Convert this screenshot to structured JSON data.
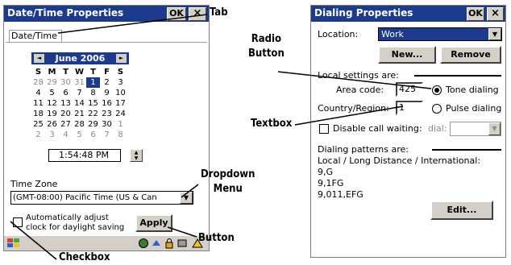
{
  "datetime_window": {
    "title": "Date/Time Properties",
    "ok_label": "OK",
    "close_glyph": "×",
    "tab_label": "Date/Time",
    "calendar": {
      "month_label": "June 2006",
      "prev_glyph": "◄",
      "next_glyph": "►",
      "dow": [
        "S",
        "M",
        "T",
        "W",
        "T",
        "F",
        "S"
      ],
      "weeks": [
        [
          [
            "28",
            true
          ],
          [
            "29",
            true
          ],
          [
            "30",
            true
          ],
          [
            "31",
            true
          ],
          [
            "1",
            false,
            true
          ],
          [
            "2",
            false
          ],
          [
            "3",
            false
          ]
        ],
        [
          [
            "4",
            false
          ],
          [
            "5",
            false
          ],
          [
            "6",
            false
          ],
          [
            "7",
            false
          ],
          [
            "8",
            false
          ],
          [
            "9",
            false
          ],
          [
            "10",
            false
          ]
        ],
        [
          [
            "11",
            false
          ],
          [
            "12",
            false
          ],
          [
            "13",
            false
          ],
          [
            "14",
            false
          ],
          [
            "15",
            false
          ],
          [
            "16",
            false
          ],
          [
            "17",
            false
          ]
        ],
        [
          [
            "18",
            false
          ],
          [
            "19",
            false
          ],
          [
            "20",
            false
          ],
          [
            "21",
            false
          ],
          [
            "22",
            false
          ],
          [
            "23",
            false
          ],
          [
            "24",
            false
          ]
        ],
        [
          [
            "25",
            false
          ],
          [
            "26",
            false
          ],
          [
            "27",
            false
          ],
          [
            "28",
            false
          ],
          [
            "29",
            false
          ],
          [
            "30",
            false
          ],
          [
            "1",
            true
          ]
        ],
        [
          [
            "2",
            true
          ],
          [
            "3",
            true
          ],
          [
            "4",
            true
          ],
          [
            "5",
            true
          ],
          [
            "6",
            true
          ],
          [
            "7",
            true
          ],
          [
            "8",
            true
          ]
        ]
      ]
    },
    "time_value": "1:54:48 PM",
    "timezone_label": "Time Zone",
    "timezone_value": "(GMT-08:00) Pacific Time (US & Can",
    "dst_label_line1": "Automatically adjust",
    "dst_label_line2": "clock for daylight saving",
    "apply_label": "Apply"
  },
  "dialing_window": {
    "title": "Dialing Properties",
    "ok_label": "OK",
    "close_glyph": "×",
    "location_label": "Location:",
    "location_value": "Work",
    "new_label": "New...",
    "remove_label": "Remove",
    "local_settings_label": "Local settings are:",
    "area_code_label": "Area code:",
    "area_code_value": "425",
    "country_label": "Country/Region:",
    "country_value": "1",
    "tone_label": "Tone dialing",
    "pulse_label": "Pulse dialing",
    "disable_wait_label": "Disable call waiting:",
    "dial_label": "dial:",
    "patterns_label": "Dialing patterns are:",
    "patterns_heading": "Local / Long Distance / International:",
    "patterns": [
      "9,G",
      "9,1FG",
      "9,011,EFG"
    ],
    "edit_label": "Edit..."
  },
  "annotations": {
    "tab": "Tab",
    "dropdown_1": "Dropdown",
    "dropdown_2": "Menu",
    "checkbox": "Checkbox",
    "button": "Button",
    "radio_1": "Radio",
    "radio_2": "Button",
    "textbox": "Textbox"
  },
  "icons": {
    "start": "windows-flag-icon",
    "tray": [
      "network-icon",
      "sync-icon",
      "lock-icon",
      "connection-icon",
      "keyboard-icon"
    ]
  },
  "colors": {
    "titlebar": "#1c3b8f",
    "chrome": "#d4d0c8"
  }
}
